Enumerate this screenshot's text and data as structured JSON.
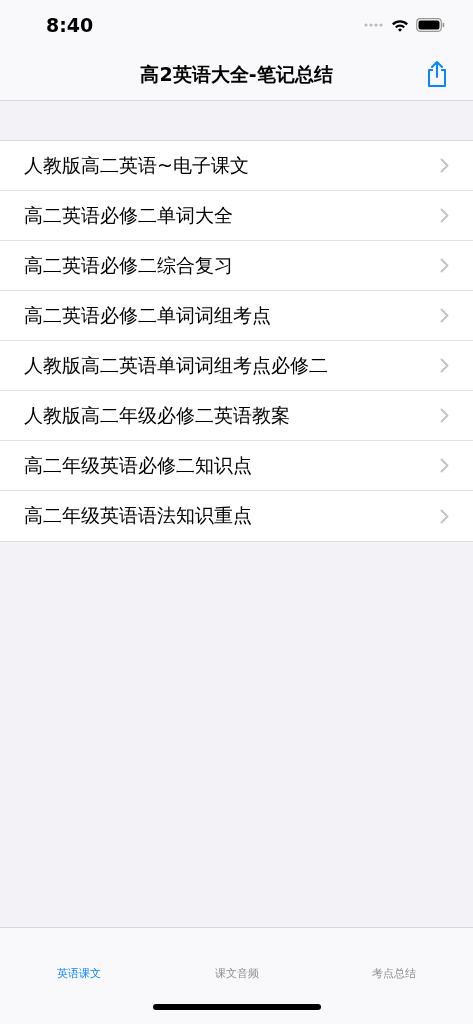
{
  "status_bar": {
    "time": "8:40"
  },
  "nav": {
    "title": "高2英语大全-笔记总结"
  },
  "list": [
    {
      "label": "人教版高二英语~电子课文"
    },
    {
      "label": "高二英语必修二单词大全"
    },
    {
      "label": "高二英语必修二综合复习"
    },
    {
      "label": "高二英语必修二单词词组考点"
    },
    {
      "label": "人教版高二英语单词词组考点必修二"
    },
    {
      "label": "人教版高二年级必修二英语教案"
    },
    {
      "label": "高二年级英语必修二知识点"
    },
    {
      "label": "高二年级英语语法知识重点"
    }
  ],
  "tabs": [
    {
      "label": "英语课文",
      "selected": true
    },
    {
      "label": "课文音频",
      "selected": false
    },
    {
      "label": "考点总结",
      "selected": false
    }
  ]
}
